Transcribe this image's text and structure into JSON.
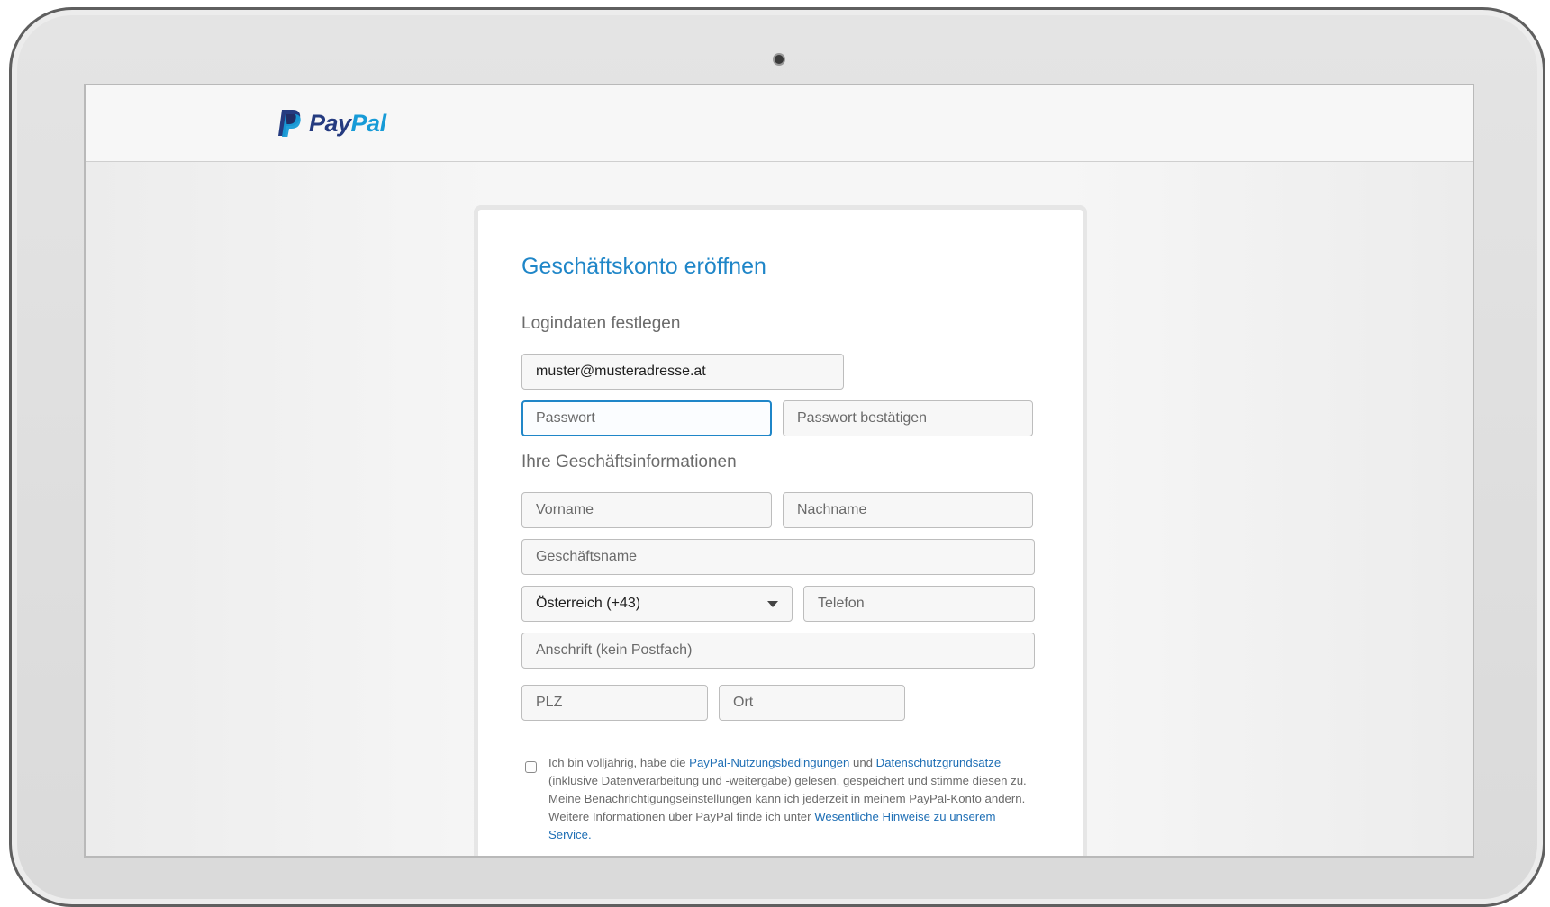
{
  "brand": {
    "name_part1": "Pay",
    "name_part2": "Pal",
    "colors": {
      "dark": "#253b80",
      "light": "#179bd7",
      "accent": "#1f86c8"
    }
  },
  "form": {
    "title": "Geschäftskonto eröffnen",
    "login_section": "Logindaten festlegen",
    "email": {
      "value": "muster@musteradresse.at"
    },
    "password": {
      "placeholder": "Passwort"
    },
    "password_confirm": {
      "placeholder": "Passwort bestätigen"
    },
    "business_section": "Ihre Geschäftsinformationen",
    "first_name": {
      "placeholder": "Vorname"
    },
    "last_name": {
      "placeholder": "Nachname"
    },
    "business_name": {
      "placeholder": "Geschäftsname"
    },
    "country_code": {
      "value": "Österreich (+43)"
    },
    "phone": {
      "placeholder": "Telefon"
    },
    "address": {
      "placeholder": "Anschrift (kein Postfach)"
    },
    "zip": {
      "placeholder": "PLZ"
    },
    "city": {
      "placeholder": "Ort"
    }
  },
  "consent": {
    "text1": "Ich bin volljährig, habe die ",
    "link1": "PayPal-Nutzungsbedingungen",
    "text2": " und ",
    "link2": "Datenschutzgrundsätze",
    "text3": " (inklusive Datenverarbeitung und -weitergabe) gelesen, gespeichert und stimme diesen zu. Meine Benachrichtigungseinstellungen kann ich jederzeit in meinem PayPal-Konto ändern. Weitere Informationen über PayPal finde ich unter ",
    "link3": "Wesentliche Hinweise zu unserem Service",
    "text4": "."
  }
}
